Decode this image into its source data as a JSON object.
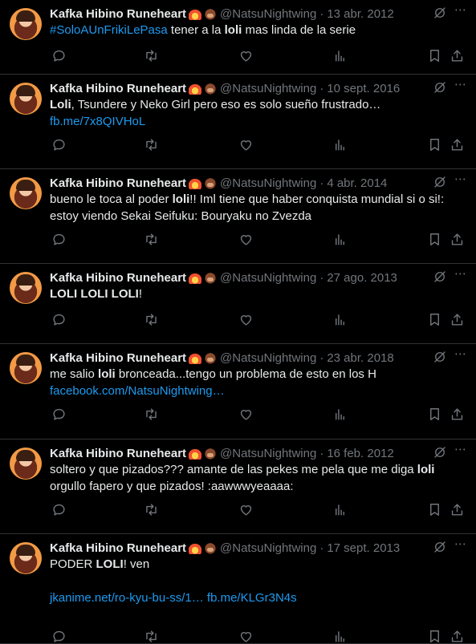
{
  "colors": {
    "background": "#000000",
    "text": "#e7e9ea",
    "muted": "#71767b",
    "link": "#1d9bf0",
    "divider": "#2f3336"
  },
  "tweets": [
    {
      "name": "Kafka Hibino Runeheart",
      "handle": "@NatsuNightwing",
      "sep": "·",
      "date": "13 abr. 2012",
      "lines": [
        {
          "parts": [
            {
              "t": "#SoloAUnFrikiLePasa",
              "k": "hashtag"
            },
            {
              "t": " tener a la ",
              "k": "text"
            },
            {
              "t": "loli",
              "k": "bold"
            },
            {
              "t": " mas linda de la serie",
              "k": "text"
            }
          ]
        }
      ]
    },
    {
      "name": "Kafka Hibino Runeheart",
      "handle": "@NatsuNightwing",
      "sep": "·",
      "date": "10 sept. 2016",
      "lines": [
        {
          "parts": [
            {
              "t": "Loli",
              "k": "bold"
            },
            {
              "t": ", Tsundere y Neko Girl pero eso es solo sueño frustrado…",
              "k": "text"
            }
          ]
        },
        {
          "parts": [
            {
              "t": "fb.me/7x8QIVHoL",
              "k": "link"
            }
          ]
        }
      ]
    },
    {
      "name": "Kafka Hibino Runeheart",
      "handle": "@NatsuNightwing",
      "sep": "·",
      "date": "4 abr. 2014",
      "lines": [
        {
          "parts": [
            {
              "t": "bueno le toca al poder ",
              "k": "text"
            },
            {
              "t": "loli",
              "k": "bold"
            },
            {
              "t": "!! Iml tiene que haber conquista mundial si o si!:",
              "k": "text"
            }
          ]
        },
        {
          "parts": [
            {
              "t": "estoy viendo Sekai Seifuku: Bouryaku no Zvezda",
              "k": "text"
            }
          ]
        }
      ]
    },
    {
      "name": "Kafka Hibino Runeheart",
      "handle": "@NatsuNightwing",
      "sep": "·",
      "date": "27 ago. 2013",
      "lines": [
        {
          "parts": [
            {
              "t": "LOLI LOLI LOLI",
              "k": "bold"
            },
            {
              "t": "!",
              "k": "text"
            }
          ]
        }
      ]
    },
    {
      "name": "Kafka Hibino Runeheart",
      "handle": "@NatsuNightwing",
      "sep": "·",
      "date": "23 abr. 2018",
      "lines": [
        {
          "parts": [
            {
              "t": "me salio ",
              "k": "text"
            },
            {
              "t": "loli",
              "k": "bold"
            },
            {
              "t": " bronceada...tengo un problema de esto en los H",
              "k": "text"
            }
          ]
        },
        {
          "parts": [
            {
              "t": "facebook.com/NatsuNightwing…",
              "k": "link"
            }
          ]
        }
      ]
    },
    {
      "name": "Kafka Hibino Runeheart",
      "handle": "@NatsuNightwing",
      "sep": "·",
      "date": "16 feb. 2012",
      "lines": [
        {
          "parts": [
            {
              "t": "soltero y que pizados??? amante de las pekes me pela que me diga ",
              "k": "text"
            },
            {
              "t": "loli",
              "k": "bold"
            }
          ]
        },
        {
          "parts": [
            {
              "t": "orgullo fapero y que pizados! :aawwwyeaaaa:",
              "k": "text"
            }
          ]
        }
      ]
    },
    {
      "name": "Kafka Hibino Runeheart",
      "handle": "@NatsuNightwing",
      "sep": "·",
      "date": "17 sept. 2013",
      "lines": [
        {
          "parts": [
            {
              "t": "PODER ",
              "k": "text"
            },
            {
              "t": "LOLI",
              "k": "bold"
            },
            {
              "t": "! ven",
              "k": "text"
            }
          ]
        },
        {
          "blank": true
        },
        {
          "parts": [
            {
              "t": "jkanime.net/ro-kyu-bu-ss/1…",
              "k": "link"
            },
            {
              "t": " ",
              "k": "text"
            },
            {
              "t": "fb.me/KLGr3N4s",
              "k": "link"
            }
          ]
        }
      ]
    }
  ],
  "icons": {
    "reply": "reply-icon",
    "retweet": "retweet-icon",
    "like": "heart-icon",
    "views": "views-icon",
    "bookmark": "bookmark-icon",
    "share": "share-icon",
    "grok": "grok-icon",
    "more": "more-icon"
  }
}
